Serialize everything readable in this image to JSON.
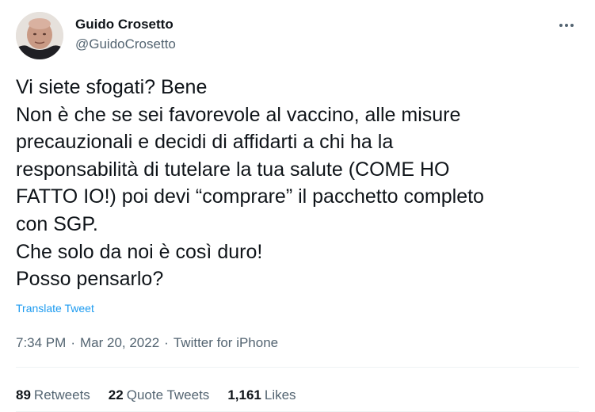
{
  "author": {
    "name": "Guido Crosetto",
    "handle": "@GuidoCrosetto"
  },
  "more_icon": "more-horizontal-icon",
  "tweet": {
    "lines": [
      "Vi siete sfogati? Bene",
      "Non è che se sei favorevole al vaccino, alle misure",
      "precauzionali e decidi di affidarti a chi ha la",
      "responsabilità di tutelare la tua salute (COME HO",
      "FATTO IO!) poi devi “comprare” il pacchetto completo",
      "con SGP.",
      "Che solo da noi è così duro!",
      "Posso pensarlo?"
    ],
    "translate_label": "Translate Tweet"
  },
  "meta": {
    "time": "7:34 PM",
    "separator": "·",
    "date": "Mar 20, 2022",
    "source": "Twitter for iPhone"
  },
  "stats": {
    "retweets": {
      "count": "89",
      "label": "Retweets"
    },
    "quote_tweets": {
      "count": "22",
      "label": "Quote Tweets"
    },
    "likes": {
      "count": "1,161",
      "label": "Likes"
    }
  },
  "colors": {
    "text": "#0f1419",
    "secondary": "#536471",
    "link": "#1d9bf0",
    "divider": "#eff3f4"
  }
}
